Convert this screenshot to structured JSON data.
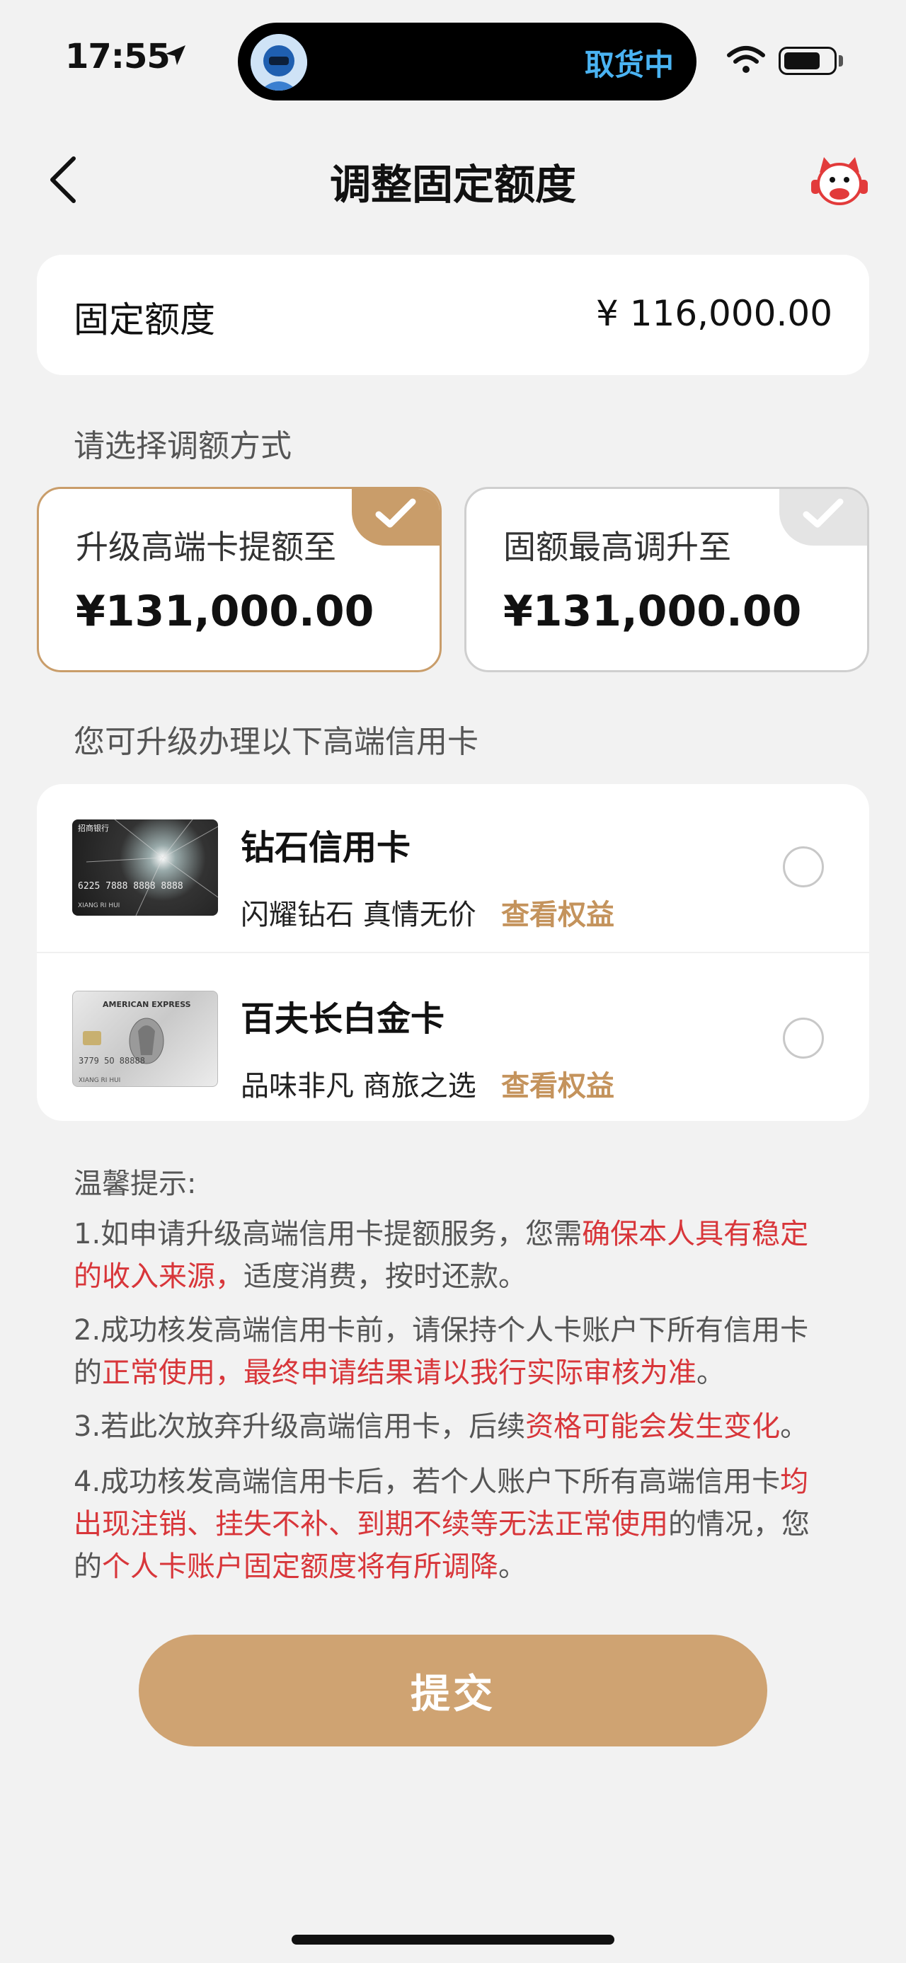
{
  "status_bar": {
    "time": "17:55",
    "island_text": "取货中"
  },
  "nav": {
    "title": "调整固定额度"
  },
  "fixed_limit": {
    "label": "固定额度",
    "value": "¥ 116,000.00"
  },
  "adjust_section": {
    "label": "请选择调额方式"
  },
  "options": [
    {
      "title": "升级高端卡提额至",
      "amount": "¥131,000.00",
      "selected": true
    },
    {
      "title": "固额最高调升至",
      "amount": "¥131,000.00",
      "selected": false
    }
  ],
  "cards_section": {
    "label": "您可升级办理以下高端信用卡"
  },
  "cards": [
    {
      "name": "钻石信用卡",
      "slogan": "闪耀钻石 真情无价",
      "link": "查看权益",
      "image_text": "招商银行",
      "image_number": "6225 7888 8888 8888",
      "image_holder": "XIANG RI HUI"
    },
    {
      "name": "百夫长白金卡",
      "slogan": "品味非凡 商旅之选",
      "link": "查看权益",
      "image_text": "AMERICAN EXPRESS",
      "image_number": "3779 5O 88888",
      "image_holder": "XIANG RI HUI"
    }
  ],
  "tips": {
    "title": "温馨提示:",
    "t1a": "1.如申请升级高端信用卡提额服务，您需",
    "t1b": "确保本人具有稳定的收入来源，",
    "t1c": "适度消费，按时还款。",
    "t2a": "2.成功核发高端信用卡前，请保持个人卡账户下所有信用卡的",
    "t2b": "正常使用，最终申请结果请以我行实际审核为准",
    "t2c": "。",
    "t3a": "3.若此次放弃升级高端信用卡，后续",
    "t3b": "资格可能会发生变化",
    "t3c": "。",
    "t4a": "4.成功核发高端信用卡后，若个人账户下所有高端信用卡",
    "t4b": "均出现注销、挂失不补、到期不续等无法正常使用",
    "t4c": "的情况，您的",
    "t4d": "个人卡账户固定额度将有所调降",
    "t4e": "。"
  },
  "submit": {
    "label": "提交"
  },
  "colors": {
    "accent": "#c99d6a",
    "red": "#d8363a",
    "background": "#f2f2f2"
  }
}
